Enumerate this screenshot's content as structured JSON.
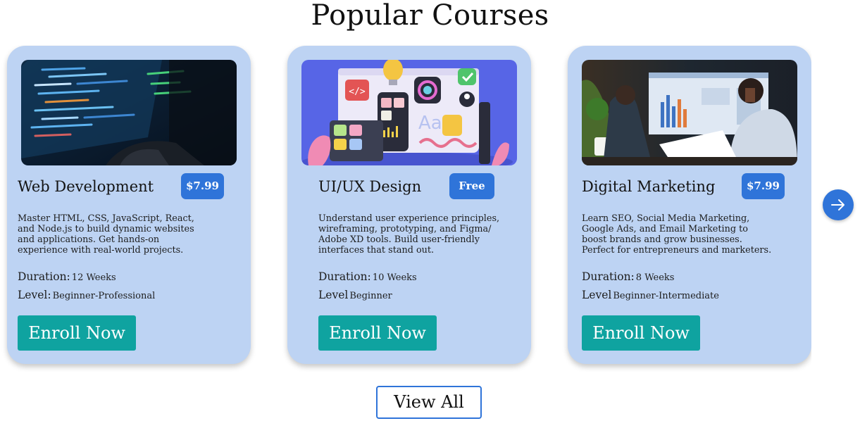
{
  "page": {
    "title": "Popular Courses"
  },
  "courses": [
    {
      "title": "Web Development",
      "price": "$7.99",
      "description": "Master HTML, CSS, JavaScript, React, and Node.js to build dynamic websites and applications. Get hands-on experience with real-world projects.",
      "duration_label": "Duration:",
      "duration": "12 Weeks",
      "level_label": "Level:",
      "level": "Beginner-Professional",
      "enroll_label": "Enroll Now",
      "image_icon": "code-on-monitor-photo"
    },
    {
      "title": "UI/UX Design",
      "price": "Free",
      "description": "Understand user experience principles, wireframing, prototyping, and Figma/ Adobe XD tools. Build user-friendly interfaces that stand out.",
      "duration_label": "Duration:",
      "duration": "10 Weeks",
      "level_label": "Level",
      "level": "Beginner",
      "enroll_label": "Enroll Now",
      "image_icon": "ui-design-illustration"
    },
    {
      "title": "Digital Marketing",
      "price": "$7.99",
      "description": "Learn SEO, Social Media Marketing, Google Ads, and Email Marketing to boost brands and grow businesses. Perfect for entrepreneurs and marketers.",
      "duration_label": "Duration:",
      "duration": "8 Weeks",
      "level_label": "Level",
      "level": "Beginner-Intermediate",
      "enroll_label": "Enroll Now",
      "image_icon": "marketing-dashboard-photo"
    }
  ],
  "actions": {
    "view_all_label": "View All",
    "next_icon": "arrow-right-icon"
  },
  "colors": {
    "card_bg": "#bdd3f3",
    "accent_blue": "#2f74d9",
    "enroll_teal": "#0fa3a0"
  }
}
